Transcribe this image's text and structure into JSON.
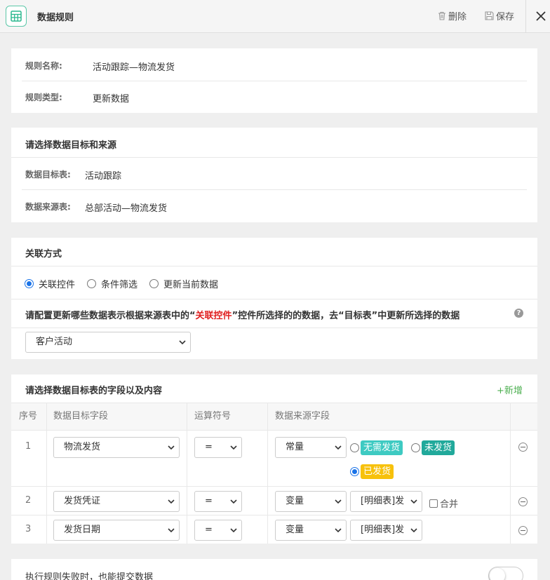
{
  "header": {
    "title": "数据规则",
    "delete_label": "删除",
    "save_label": "保存"
  },
  "rule": {
    "name_label": "规则名称:",
    "name_value": "活动跟踪—物流发货",
    "type_label": "规则类型:",
    "type_value": "更新数据"
  },
  "source": {
    "section_title": "请选择数据目标和来源",
    "target_label": "数据目标表:",
    "target_value": "活动跟踪",
    "source_label": "数据来源表:",
    "source_value": "总部活动—物流发货"
  },
  "relation": {
    "section_title": "关联方式",
    "options": [
      "关联控件",
      "条件筛选",
      "更新当前数据"
    ],
    "selected_index": 0,
    "desc_prefix": "请配置更新哪些数据表示根据来源表中的“",
    "desc_highlight": "关联控件",
    "desc_suffix": "”控件所选择的的数据，去“目标表”中更新所选择的数据",
    "control_select": "客户活动"
  },
  "fields": {
    "section_title": "请选择数据目标表的字段以及内容",
    "add_label": "新增",
    "columns": [
      "序号",
      "数据目标字段",
      "运算符号",
      "数据来源字段"
    ],
    "rows": [
      {
        "index": "1",
        "target": "物流发货",
        "op": "=",
        "source_type": "常量",
        "options": [
          "无需发货",
          "未发货",
          "已发货"
        ],
        "selected_option": 2
      },
      {
        "index": "2",
        "target": "发货凭证",
        "op": "=",
        "source_type": "变量",
        "source_field": "[明细表]发",
        "merge_label": "合并"
      },
      {
        "index": "3",
        "target": "发货日期",
        "op": "=",
        "source_type": "变量",
        "source_field": "[明细表]发"
      }
    ]
  },
  "footer": {
    "submit_on_fail_label": "执行规则失败时，也能提交数据",
    "toggle_on": false
  },
  "colors": {
    "accent": "#1a73e8",
    "add": "#4caf50",
    "highlight": "#e02020",
    "tag_none": "#3ecac2",
    "tag_pending": "#21a99b",
    "tag_sent": "#f7c10b"
  }
}
